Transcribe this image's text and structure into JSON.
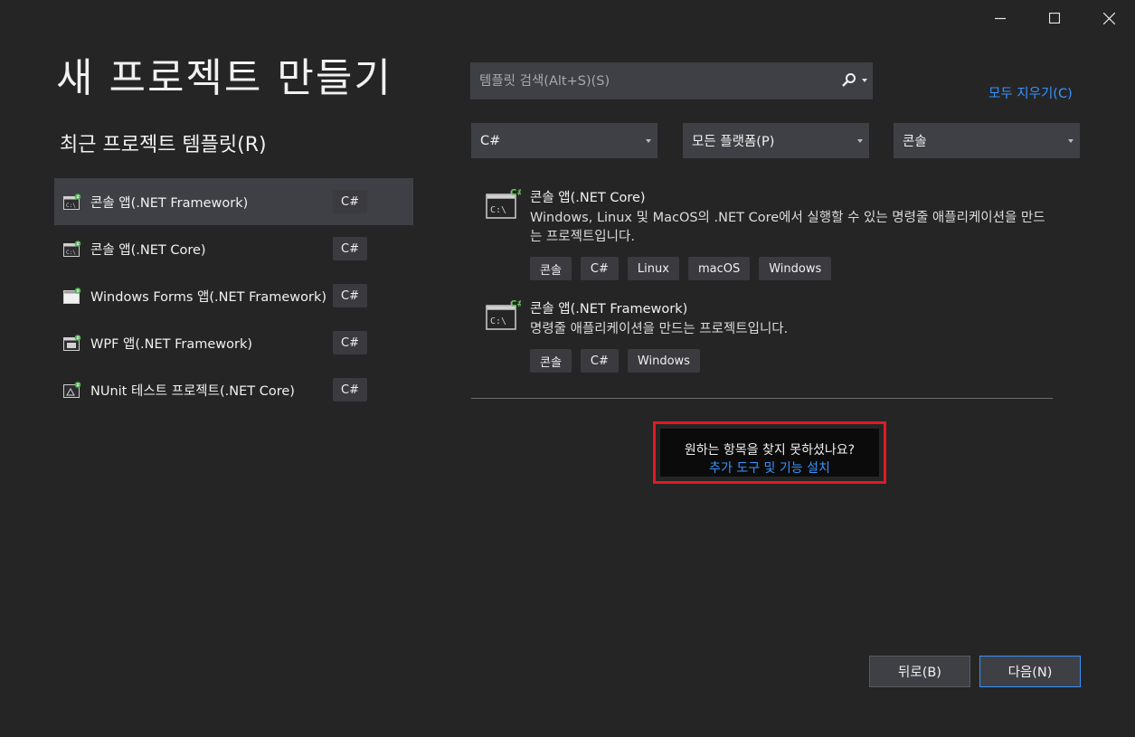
{
  "window": {
    "minimize_icon": "minimize-icon",
    "maximize_icon": "maximize-icon",
    "close_icon": "close-icon"
  },
  "page_title": "새 프로젝트 만들기",
  "recent": {
    "title": "최근 프로젝트 템플릿(R)",
    "items": [
      {
        "label": "콘솔 앱(.NET Framework)",
        "tag": "C#",
        "selected": true,
        "icon": "console-app-icon"
      },
      {
        "label": "콘솔 앱(.NET Core)",
        "tag": "C#",
        "selected": false,
        "icon": "console-app-icon"
      },
      {
        "label": "Windows Forms 앱(.NET Framework)",
        "tag": "C#",
        "selected": false,
        "icon": "windows-forms-icon"
      },
      {
        "label": "WPF 앱(.NET Framework)",
        "tag": "C#",
        "selected": false,
        "icon": "wpf-app-icon"
      },
      {
        "label": "NUnit 테스트 프로젝트(.NET Core)",
        "tag": "C#",
        "selected": false,
        "icon": "test-project-icon"
      }
    ]
  },
  "search": {
    "placeholder": "템플릿 검색(Alt+S)(S)",
    "value": ""
  },
  "clear_all": "모두 지우기(C)",
  "filters": {
    "language": "C#",
    "platform": "모든 플랫폼(P)",
    "project_type": "콘솔"
  },
  "results": [
    {
      "title": "콘솔 앱(.NET Core)",
      "description": "Windows, Linux 및 MacOS의 .NET Core에서 실행할 수 있는 명령줄 애플리케이션을 만드는 프로젝트입니다.",
      "tags": [
        "콘솔",
        "C#",
        "Linux",
        "macOS",
        "Windows"
      ]
    },
    {
      "title": "콘솔 앱(.NET Framework)",
      "description": "명령줄 애플리케이션을 만드는 프로젝트입니다.",
      "tags": [
        "콘솔",
        "C#",
        "Windows"
      ]
    }
  ],
  "not_found": {
    "question": "원하는 항목을 찾지 못하셨나요?",
    "link": "추가 도구 및 기능 설치"
  },
  "buttons": {
    "back": "뒤로(B)",
    "next": "다음(N)"
  },
  "colors": {
    "background": "#252526",
    "accent_link": "#3794ff",
    "highlight_border": "#e01b24",
    "selected_item": "#3f3f46"
  }
}
